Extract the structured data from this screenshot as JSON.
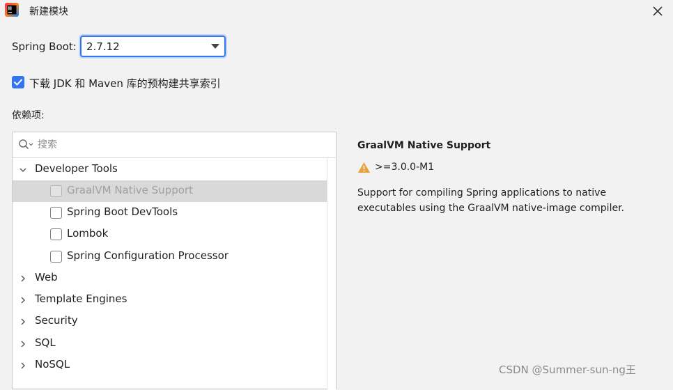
{
  "window": {
    "title": "新建模块"
  },
  "spring_boot": {
    "label": "Spring Boot:",
    "selected_version": "2.7.12"
  },
  "download_index": {
    "checked": true,
    "label": "下载 JDK 和 Maven 库的预构建共享索引"
  },
  "dependencies": {
    "label": "依赖项:",
    "search_placeholder": "搜索",
    "tree": [
      {
        "group": "Developer Tools",
        "expanded": true,
        "items": [
          {
            "label": "GraalVM Native Support",
            "checked": false,
            "disabled": true,
            "selected": true
          },
          {
            "label": "Spring Boot DevTools",
            "checked": false
          },
          {
            "label": "Lombok",
            "checked": false
          },
          {
            "label": "Spring Configuration Processor",
            "checked": false
          }
        ]
      },
      {
        "group": "Web",
        "expanded": false
      },
      {
        "group": "Template Engines",
        "expanded": false
      },
      {
        "group": "Security",
        "expanded": false
      },
      {
        "group": "SQL",
        "expanded": false
      },
      {
        "group": "NoSQL",
        "expanded": false
      }
    ]
  },
  "details": {
    "title": "GraalVM Native Support",
    "version_requirement": ">=3.0.0-M1",
    "description": "Support for compiling Spring applications to native executables using the GraalVM native-image compiler."
  },
  "watermark": "CSDN @Summer-sun-ng王"
}
